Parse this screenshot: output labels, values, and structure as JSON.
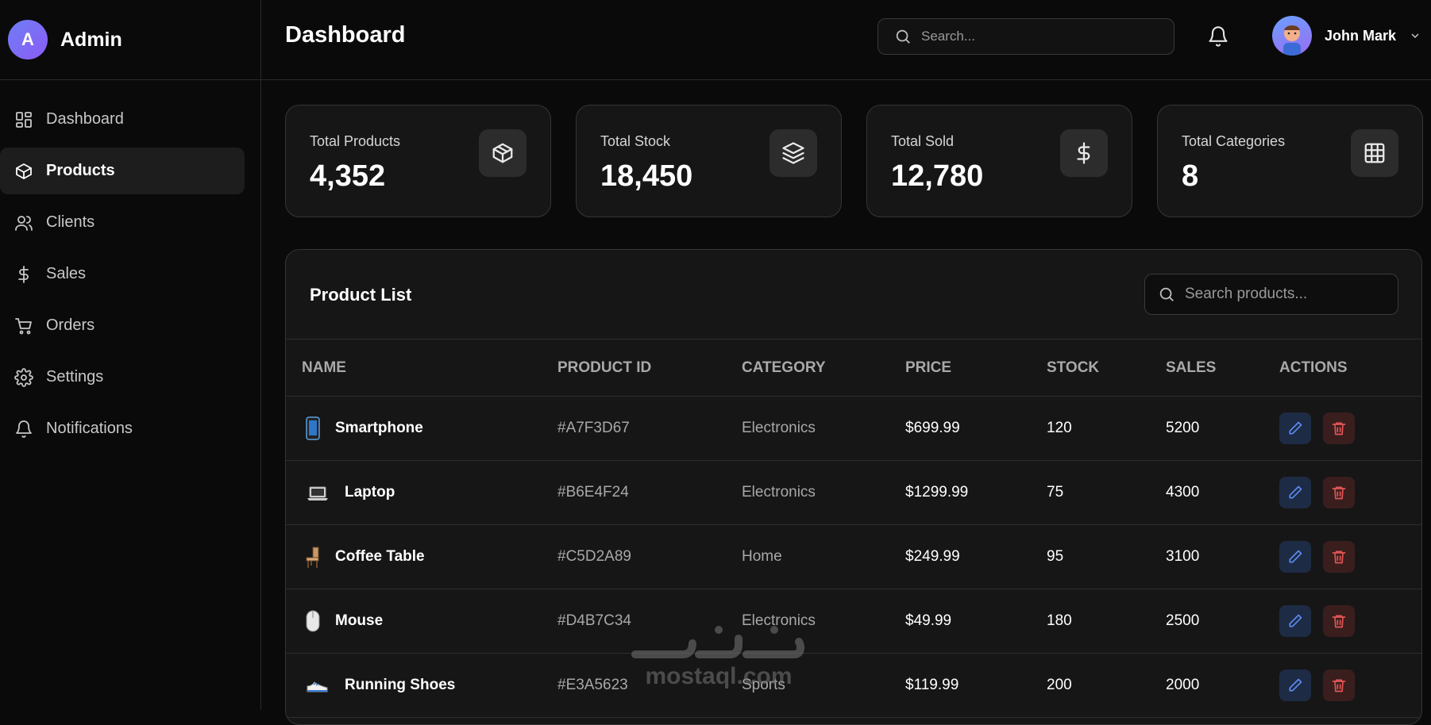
{
  "sidebar": {
    "brand_initial": "A",
    "brand_title": "Admin",
    "items": [
      {
        "label": "Dashboard",
        "icon": "grid-icon"
      },
      {
        "label": "Products",
        "icon": "box-icon",
        "active": true
      },
      {
        "label": "Clients",
        "icon": "users-icon"
      },
      {
        "label": "Sales",
        "icon": "dollar-icon"
      },
      {
        "label": "Orders",
        "icon": "cart-icon"
      },
      {
        "label": "Settings",
        "icon": "gear-icon"
      },
      {
        "label": "Notifications",
        "icon": "bell-icon"
      }
    ]
  },
  "header": {
    "title": "Dashboard",
    "search_placeholder": "Search...",
    "user_name": "John Mark"
  },
  "stats": [
    {
      "label": "Total Products",
      "value": "4,352",
      "icon": "box-icon"
    },
    {
      "label": "Total Stock",
      "value": "18,450",
      "icon": "layers-icon"
    },
    {
      "label": "Total Sold",
      "value": "12,780",
      "icon": "dollar-icon"
    },
    {
      "label": "Total Categories",
      "value": "8",
      "icon": "grid-table-icon"
    }
  ],
  "product_list": {
    "title": "Product List",
    "search_placeholder": "Search products...",
    "columns": [
      "NAME",
      "PRODUCT ID",
      "CATEGORY",
      "PRICE",
      "STOCK",
      "SALES",
      "ACTIONS"
    ],
    "rows": [
      {
        "name": "Smartphone",
        "icon": "smartphone-icon",
        "id": "#A7F3D67",
        "category": "Electronics",
        "price": "$699.99",
        "stock": "120",
        "sales": "5200"
      },
      {
        "name": "Laptop",
        "icon": "laptop-icon",
        "id": "#B6E4F24",
        "category": "Electronics",
        "price": "$1299.99",
        "stock": "75",
        "sales": "4300"
      },
      {
        "name": "Coffee Table",
        "icon": "chair-icon",
        "id": "#C5D2A89",
        "category": "Home",
        "price": "$249.99",
        "stock": "95",
        "sales": "3100"
      },
      {
        "name": "Mouse",
        "icon": "mouse-icon",
        "id": "#D4B7C34",
        "category": "Electronics",
        "price": "$49.99",
        "stock": "180",
        "sales": "2500"
      },
      {
        "name": "Running Shoes",
        "icon": "shoe-icon",
        "id": "#E3A5623",
        "category": "Sports",
        "price": "$119.99",
        "stock": "200",
        "sales": "2000"
      }
    ]
  },
  "watermark": {
    "text": "mostaql.com"
  },
  "colors": {
    "accent": "#6f7df5",
    "edit": "#5b8cf5",
    "delete": "#e35555",
    "background": "#0a0a0a",
    "card": "#161616"
  }
}
